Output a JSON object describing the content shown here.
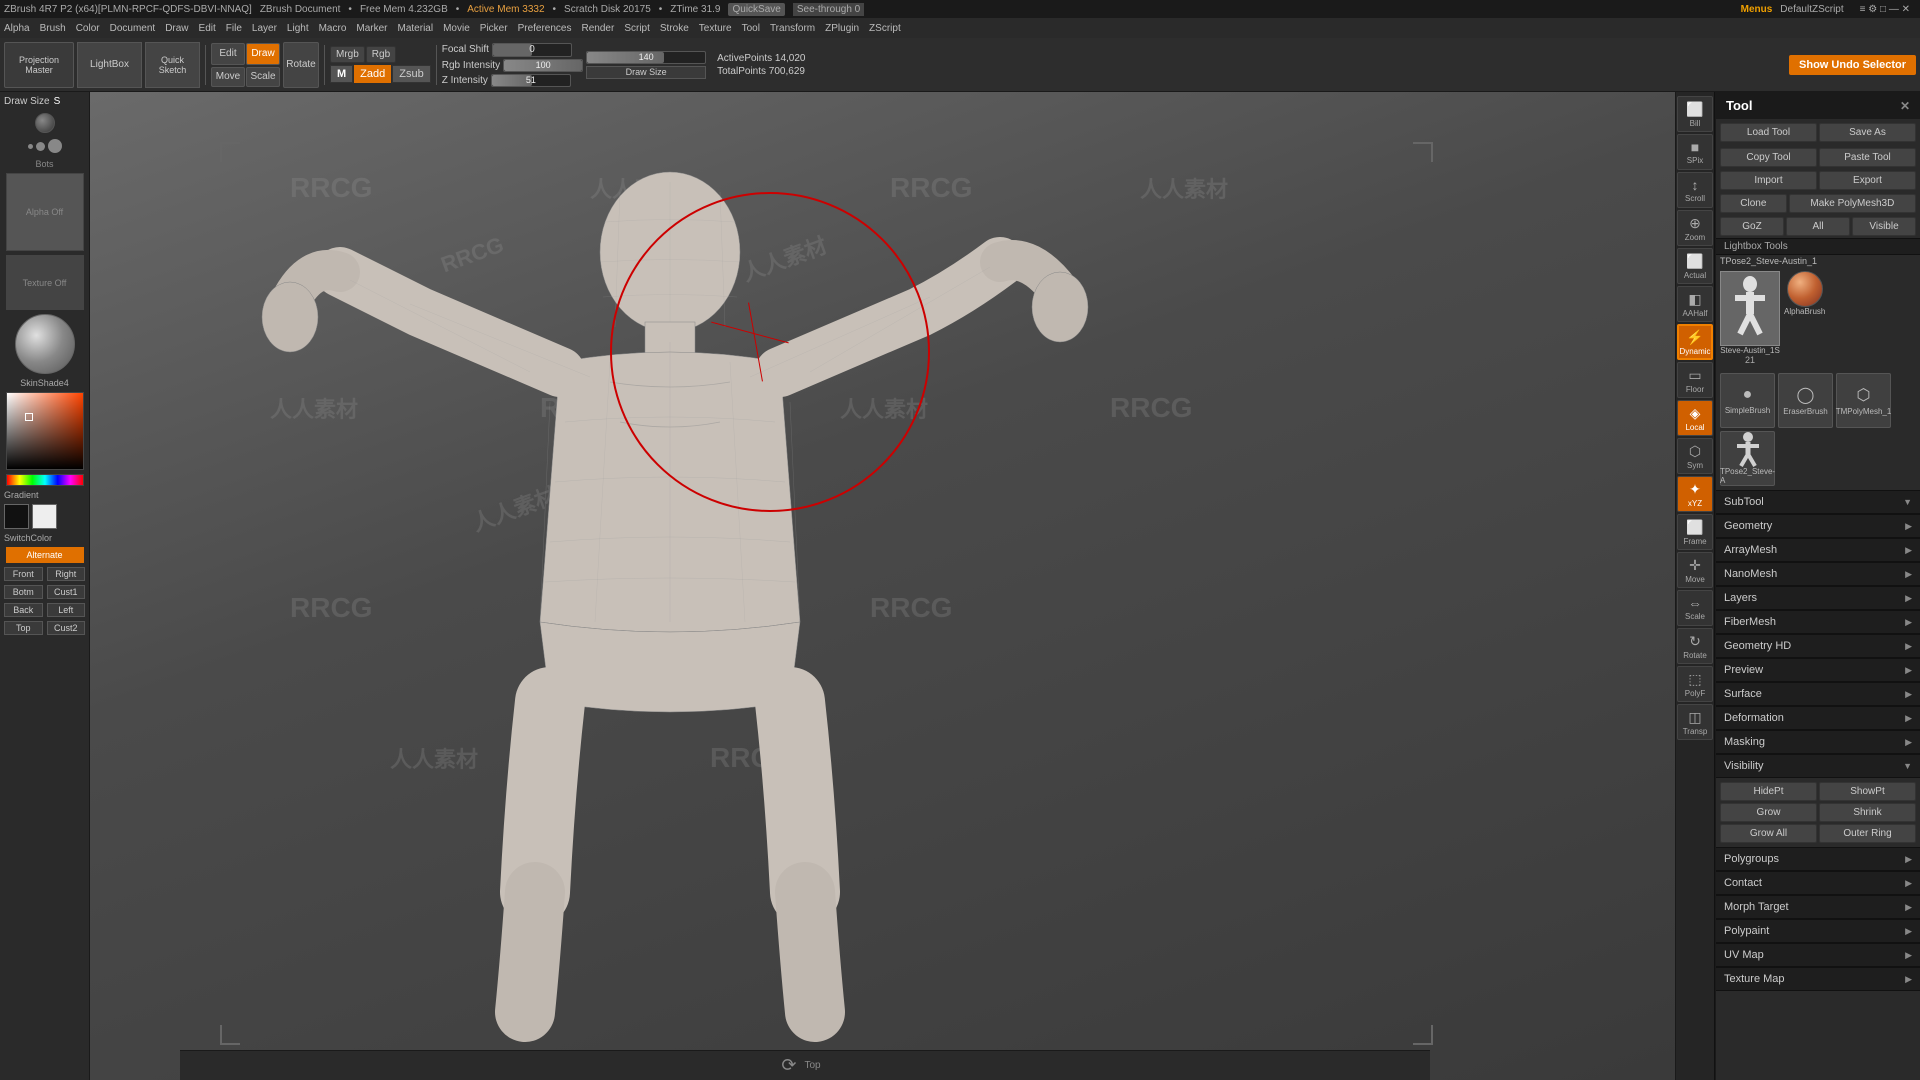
{
  "topbar": {
    "title": "ZBrush 4R7 P2 (x64)[PLMN-RPCF-QDFS-DBVI-NNAQ]",
    "document": "ZBrush Document",
    "free_mem": "Free Mem 4.232GB",
    "active_mem": "Active Mem 3332",
    "scratch_disk": "Scratch Disk 20175",
    "ztime": "ZTime 31.9",
    "quicksave": "QuickSave",
    "see_through": "See-through 0",
    "menus": "Menus",
    "default_zscript": "DefaultZScript"
  },
  "menubar": {
    "items": [
      "Alpha",
      "Brush",
      "Color",
      "Document",
      "Draw",
      "Edit",
      "File",
      "Layer",
      "Light",
      "Macro",
      "Marker",
      "Material",
      "Movie",
      "Picker",
      "Preferences",
      "Render",
      "Script",
      "Stroke",
      "Texture",
      "Tool",
      "Transform",
      "ZPlugin",
      "ZScript"
    ]
  },
  "toolbar": {
    "projection_master": "Projection\nMaster",
    "lightbox": "LightBox",
    "quick_sketch": "Quick\nSketch",
    "edit": "Edit",
    "draw": "Draw",
    "move": "Move",
    "scale": "Scale",
    "rotate": "Rotate",
    "mrgb": "Mrgb",
    "rgb": "Rgb",
    "m_label": "M",
    "zadd": "Zadd",
    "zsub": "Zsub",
    "focal_shift": "Focal Shift",
    "focal_value": "0",
    "rgb_intensity_label": "Rgb Intensity",
    "rgb_intensity_value": "100",
    "z_intensity_label": "Z Intensity",
    "z_intensity_value": "51",
    "draw_size_label": "140",
    "active_points": "ActivePoints 14,020",
    "total_points": "TotalPoints 700,629",
    "show_undo_selector": "Show Undo Selector"
  },
  "left_panel": {
    "draw_size_label": "Draw Size",
    "draw_size_value": "S",
    "alpha_label": "Alpha Off",
    "texture_label": "Texture Off",
    "material_label": "SkinShade4",
    "gradient_label": "Gradient",
    "switch_color_label": "SwitchColor",
    "alternate_label": "Alternate",
    "nav_buttons": [
      "Front",
      "Right",
      "Botm",
      "Cust1",
      "Back",
      "Left",
      "Top",
      "Cust2"
    ]
  },
  "right_icons": {
    "buttons": [
      {
        "label": "Bill",
        "icon": "⬜"
      },
      {
        "label": "SPix",
        "icon": "◼"
      },
      {
        "label": "Scroll",
        "icon": "↕"
      },
      {
        "label": "Zoom",
        "icon": "🔍"
      },
      {
        "label": "Actual",
        "icon": "⬜"
      },
      {
        "label": "AAHalf",
        "icon": "⬜"
      },
      {
        "label": "Dynamic\nProp",
        "icon": "⚡"
      },
      {
        "label": "Floor",
        "icon": "⬜"
      },
      {
        "label": "Local",
        "icon": "⬛"
      },
      {
        "label": "Sym",
        "icon": "⬜"
      },
      {
        "label": "xYZ",
        "icon": "◈"
      },
      {
        "label": "Frame",
        "icon": "⬜"
      },
      {
        "label": "Move",
        "icon": "↔"
      },
      {
        "label": "Scale",
        "icon": "⇔"
      },
      {
        "label": "Rotate",
        "icon": "↻"
      },
      {
        "label": "PolyF",
        "icon": "⬜"
      },
      {
        "label": "Transp",
        "icon": "◫"
      }
    ]
  },
  "right_panel": {
    "title": "Tool",
    "load": "Load Tool",
    "save": "Save As",
    "copy": "Copy Tool",
    "paste": "Paste Tool",
    "import": "Import",
    "export": "Export",
    "clone": "Clone",
    "make_polymesh": "Make PolyMesh3D",
    "goz": "GoZ",
    "all": "All",
    "visible": "Visible",
    "lightbox_tools": "Lightbox Tools",
    "tpose_label": "TPose2_Steve-Austin_1",
    "brush_labels": [
      "SimpleBrush",
      "EraserBrush",
      "TMPolyMesh_1",
      "TPose2_Steve-A"
    ],
    "sections": [
      {
        "name": "SubTool",
        "key": "subtool"
      },
      {
        "name": "Geometry",
        "key": "geometry"
      },
      {
        "name": "ArrayMesh",
        "key": "arraymesh"
      },
      {
        "name": "NanoMesh",
        "key": "nanomesh"
      },
      {
        "name": "Layers",
        "key": "layers"
      },
      {
        "name": "FiberMesh",
        "key": "fibermesh"
      },
      {
        "name": "Geometry HD",
        "key": "geometryhd"
      },
      {
        "name": "Preview",
        "key": "preview"
      },
      {
        "name": "Surface",
        "key": "surface"
      },
      {
        "name": "Deformation",
        "key": "deformation"
      },
      {
        "name": "Masking",
        "key": "masking"
      },
      {
        "name": "Visibility",
        "key": "visibility"
      },
      {
        "name": "Polygroups",
        "key": "polygroups"
      },
      {
        "name": "Contact",
        "key": "contact"
      },
      {
        "name": "Morph Target",
        "key": "morphtarget"
      },
      {
        "name": "Polypaint",
        "key": "polypaint"
      },
      {
        "name": "UV Map",
        "key": "uvmap"
      },
      {
        "name": "Texture Map",
        "key": "texturemap"
      }
    ],
    "visibility": {
      "hide_pt": "HidePt",
      "show_pt": "ShowPt",
      "grow": "Grow",
      "shrink": "Shrink",
      "grow_all": "Grow All",
      "outer_ring": "Outer Ring"
    },
    "subtool_name": "Steve-Austin_1S",
    "subtool_r": "21"
  },
  "viewport": {
    "bottom_label": "Top"
  },
  "watermarks": [
    "RRCG",
    "人人素材",
    "RRCG",
    "人人素材",
    "RRCG",
    "人人素材"
  ]
}
